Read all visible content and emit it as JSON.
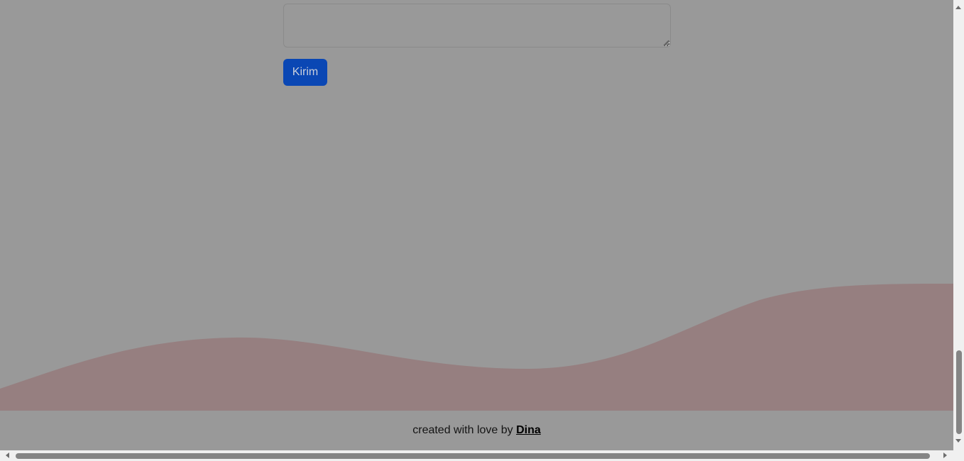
{
  "form": {
    "message_value": "",
    "submit_label": "Kirim",
    "submit_color": "#0a47b4"
  },
  "decoration": {
    "wave_color": "#967f80",
    "background_color": "#999999"
  },
  "footer": {
    "prefix": "created with love by ",
    "author": "Dina"
  },
  "scrollbars": {
    "vertical_icon_up": "arrow-up-icon",
    "vertical_icon_down": "arrow-down-icon",
    "horizontal_icon_left": "arrow-left-icon",
    "horizontal_icon_right": "arrow-right-icon"
  }
}
